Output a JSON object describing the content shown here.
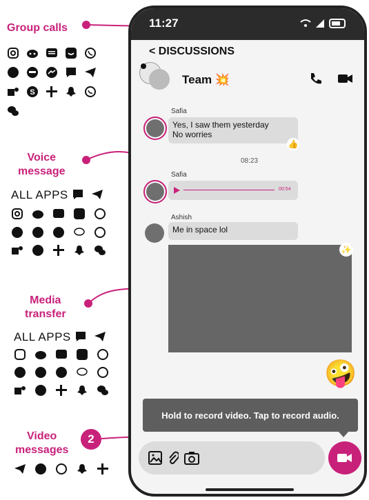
{
  "annotations": {
    "group_calls": "Group calls",
    "voice_message": "Voice\nmessage",
    "media_transfer": "Media\ntransfer",
    "video_messages": "Video\nmessages",
    "all_apps_label": "ALL APPS",
    "badge_number": "2"
  },
  "phone": {
    "time": "11:27",
    "back_label": "< DISCUSSIONS",
    "chat_title": "Team",
    "title_emoji": "💥",
    "messages": [
      {
        "sender": "Safia",
        "text_line1": "Yes, I saw them yesterday",
        "text_line2": "No worries",
        "reaction": "👍"
      },
      {
        "timestamp": "08:23"
      },
      {
        "sender": "Safia",
        "voice_duration": "00:54"
      },
      {
        "sender": "Ashish",
        "text": "Me in space lol",
        "media_reaction": "✨"
      }
    ],
    "sticker": "🤪",
    "tooltip": "Hold to record video. Tap to record audio."
  },
  "colors": {
    "accent": "#c8217a",
    "bubble": "#dcdcdc",
    "media": "#666666"
  }
}
